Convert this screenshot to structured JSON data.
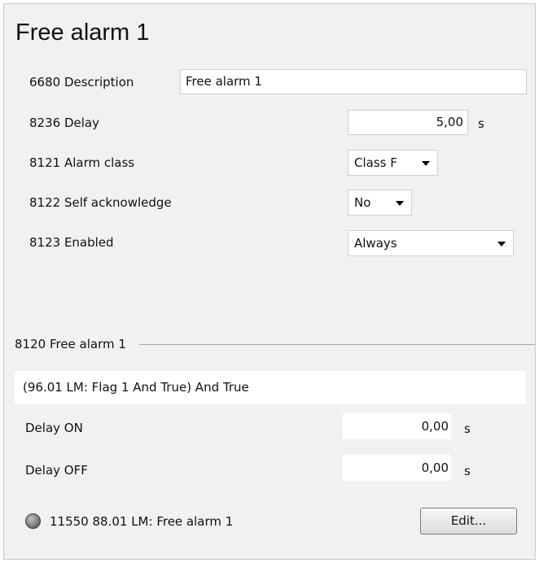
{
  "header": {
    "title": "Free alarm 1"
  },
  "params": {
    "description": {
      "label": "6680 Description",
      "value": "Free alarm 1"
    },
    "delay": {
      "label": "8236 Delay",
      "value": "5,00",
      "unit": "s"
    },
    "alarm_class": {
      "label": "8121 Alarm class",
      "selected": "Class F"
    },
    "self_ack": {
      "label": "8122 Self acknowledge",
      "selected": "No"
    },
    "enabled": {
      "label": "8123 Enabled",
      "selected": "Always"
    }
  },
  "logic": {
    "section_label": "8120 Free alarm 1",
    "expression": "(96.01 LM: Flag 1 And True) And True",
    "delay_on": {
      "label": "Delay ON",
      "value": "0,00",
      "unit": "s"
    },
    "delay_off": {
      "label": "Delay OFF",
      "value": "0,00",
      "unit": "s"
    },
    "status": {
      "text": "11550 88.01 LM: Free alarm 1",
      "led_color": "#8a8a8a"
    },
    "edit_label": "Edit..."
  }
}
